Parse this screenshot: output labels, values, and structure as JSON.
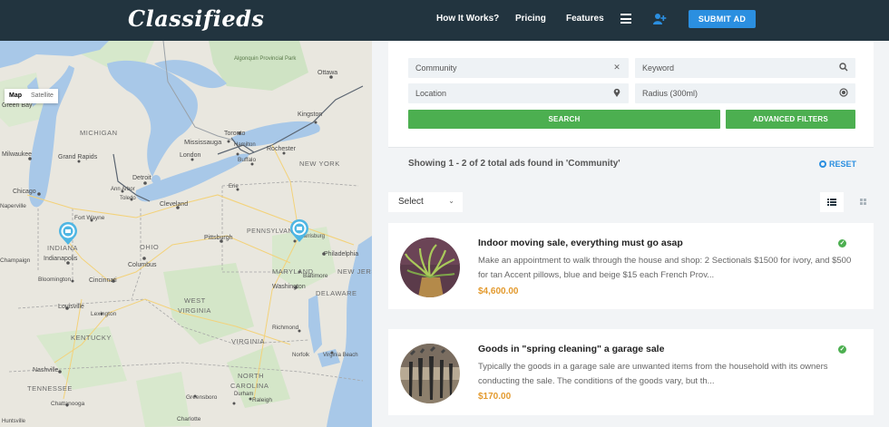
{
  "header": {
    "logo": "Classifieds",
    "nav": [
      "How It Works?",
      "Pricing",
      "Features"
    ],
    "submit_label": "SUBMIT AD",
    "menu_icon": "hamburger-icon",
    "user_icon": "add-user-icon"
  },
  "map": {
    "type_active": "Map",
    "type_inactive": "Satellite",
    "labels": {
      "algonquin": "Algonquin Provincial Park",
      "ottawa": "Ottawa",
      "green_bay": "Green Bay",
      "kingston": "Kingston",
      "michigan": "MICHIGAN",
      "toronto": "Toronto",
      "mississauga": "Mississauga",
      "hamilton": "Hamilton",
      "milwaukee": "Milwaukee",
      "grand_rapids": "Grand Rapids",
      "london": "London",
      "rochester": "Rochester",
      "buffalo": "Buffalo",
      "detroit": "Detroit",
      "new_york": "NEW YORK",
      "chicago": "Chicago",
      "ann_arbor": "Ann Arbor",
      "toledo": "Toledo",
      "erie": "Erie",
      "naperville": "Naperville",
      "cleveland": "Cleveland",
      "fort_wayne": "Fort Wayne",
      "pennsylvania": "PENNSYLVANIA",
      "indiana": "INDIANA",
      "ohio": "OHIO",
      "pittsburgh": "Pittsburgh",
      "harrisburg": "Harrisburg",
      "philadelphia": "Philadelphia",
      "champaign": "Champaign",
      "indianapolis": "Indianapolis",
      "columbus": "Columbus",
      "bloomington": "Bloomington",
      "cincinnati": "Cincinnati",
      "maryland": "MARYLAND",
      "new_jersey": "NEW JERS",
      "baltimore": "Baltimore",
      "washington": "Washington",
      "delaware": "DELAWARE",
      "west": "WEST",
      "virginia_w": "VIRGINIA",
      "louisville": "Louisville",
      "lexington": "Lexington",
      "kentucky": "KENTUCKY",
      "virginia": "VIRGINIA",
      "richmond": "Richmond",
      "norfolk": "Norfolk",
      "virginia_beach": "Virginia Beach",
      "nashville": "Nashville",
      "north": "NORTH",
      "carolina": "CAROLINA",
      "tennessee": "TENNESSEE",
      "greensboro": "Greensboro",
      "raleigh": "Raleigh",
      "chattanooga": "Chattanooga",
      "charlotte": "Charlotte",
      "huntsville": "Huntsville",
      "durham": "Durham"
    },
    "marker_icon": "location-pin-icon"
  },
  "search": {
    "community_value": "Community",
    "keyword_placeholder": "Keyword",
    "location_placeholder": "Location",
    "radius_value": "Radius (300ml)",
    "search_label": "SEARCH",
    "advanced_label": "ADVANCED FILTERS"
  },
  "results": {
    "summary": "Showing 1 - 2 of 2 total ads found in 'Community'",
    "reset_label": "RESET",
    "sort_label": "Select"
  },
  "listings": [
    {
      "title": "Indoor moving sale, everything must go asap",
      "description": "Make an appointment to walk through the house and shop: 2 Sectionals $1500 for ivory, and $500 for tan Accent pillows, blue and beige $15 each French Prov...",
      "price": "$4,600.00"
    },
    {
      "title": "Goods in \"spring cleaning\" a garage sale",
      "description": "Typically the goods in a garage sale are unwanted items from the household with its owners conducting the sale. The conditions of the goods vary, but th...",
      "price": "$170.00"
    }
  ],
  "colors": {
    "header_bg": "#22343f",
    "accent_blue": "#2b8fe0",
    "accent_green": "#4caf50",
    "price_orange": "#e39a2e",
    "water": "#a8c8e8"
  }
}
